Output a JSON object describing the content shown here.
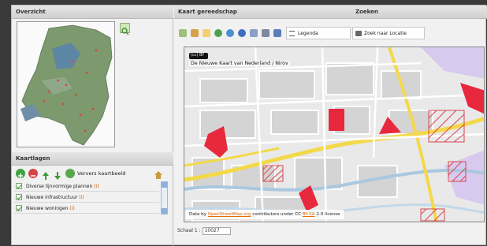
{
  "panels": {
    "overview_title": "Overzicht",
    "layers_title": "Kaartlagen",
    "tools_title": "Kaart gereedschap",
    "search_title": "Zoeken"
  },
  "layers_toolbar": {
    "refresh_label": "Ververs kaartbeeld"
  },
  "layers": [
    {
      "label": "Diverse lijnvormige plannen",
      "info": "(i)"
    },
    {
      "label": "Nieuwe infrastructuur",
      "info": "(i)"
    },
    {
      "label": "Nieuwe woningen",
      "info": "(i)"
    }
  ],
  "toolbar": {
    "legend_label": "Legenda",
    "search_location_label": "Zoek naar Locatie"
  },
  "map": {
    "title": "De Nieuwe Kaart van Nederland / Nirov",
    "cc_badge": "(cc) BY",
    "attribution": {
      "prefix": "Data by",
      "osm_link": "OpenStreetMap.org",
      "middle": "contributors under CC",
      "license_link": "BY-SA",
      "suffix": "2.0 license"
    }
  },
  "scale": {
    "label": "Schaal 1 :",
    "value": "10027"
  },
  "colors": {
    "plan_red": "#e8283c",
    "road_yellow": "#f3d94a",
    "park_purple": "#d8c9ee"
  }
}
